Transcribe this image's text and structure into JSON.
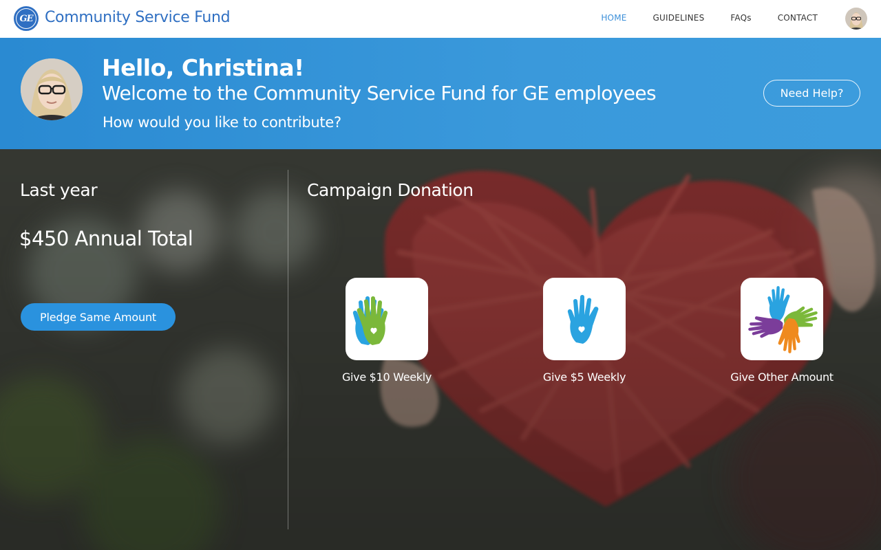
{
  "header": {
    "logo_text": "GE",
    "brand": "Community Service Fund",
    "nav": [
      {
        "label": "HOME",
        "active": true
      },
      {
        "label": "GUIDELINES",
        "active": false
      },
      {
        "label": "FAQs",
        "active": false
      },
      {
        "label": "CONTACT",
        "active": false
      }
    ]
  },
  "banner": {
    "greeting": "Hello, Christina!",
    "welcome": "Welcome to the Community Service Fund for GE employees",
    "question": "How would you like to contribute?",
    "help_label": "Need Help?"
  },
  "last_year": {
    "title": "Last year",
    "total": "$450 Annual Total",
    "pledge_label": "Pledge Same Amount"
  },
  "campaign": {
    "title": "Campaign Donation",
    "options": [
      {
        "label": "Give $10 Weekly",
        "icon": "two-hands-icon"
      },
      {
        "label": "Give $5 Weekly",
        "icon": "one-hand-icon"
      },
      {
        "label": "Give Other Amount",
        "icon": "four-hands-icon"
      }
    ]
  },
  "colors": {
    "brand_blue": "#2f6fc2",
    "banner_blue": "#3a99db",
    "button_blue": "#2a92de",
    "hand_blue": "#2aa3e0",
    "hand_green": "#7bb83a",
    "hand_purple": "#7b3d9a",
    "hand_orange": "#ef8a1e"
  }
}
